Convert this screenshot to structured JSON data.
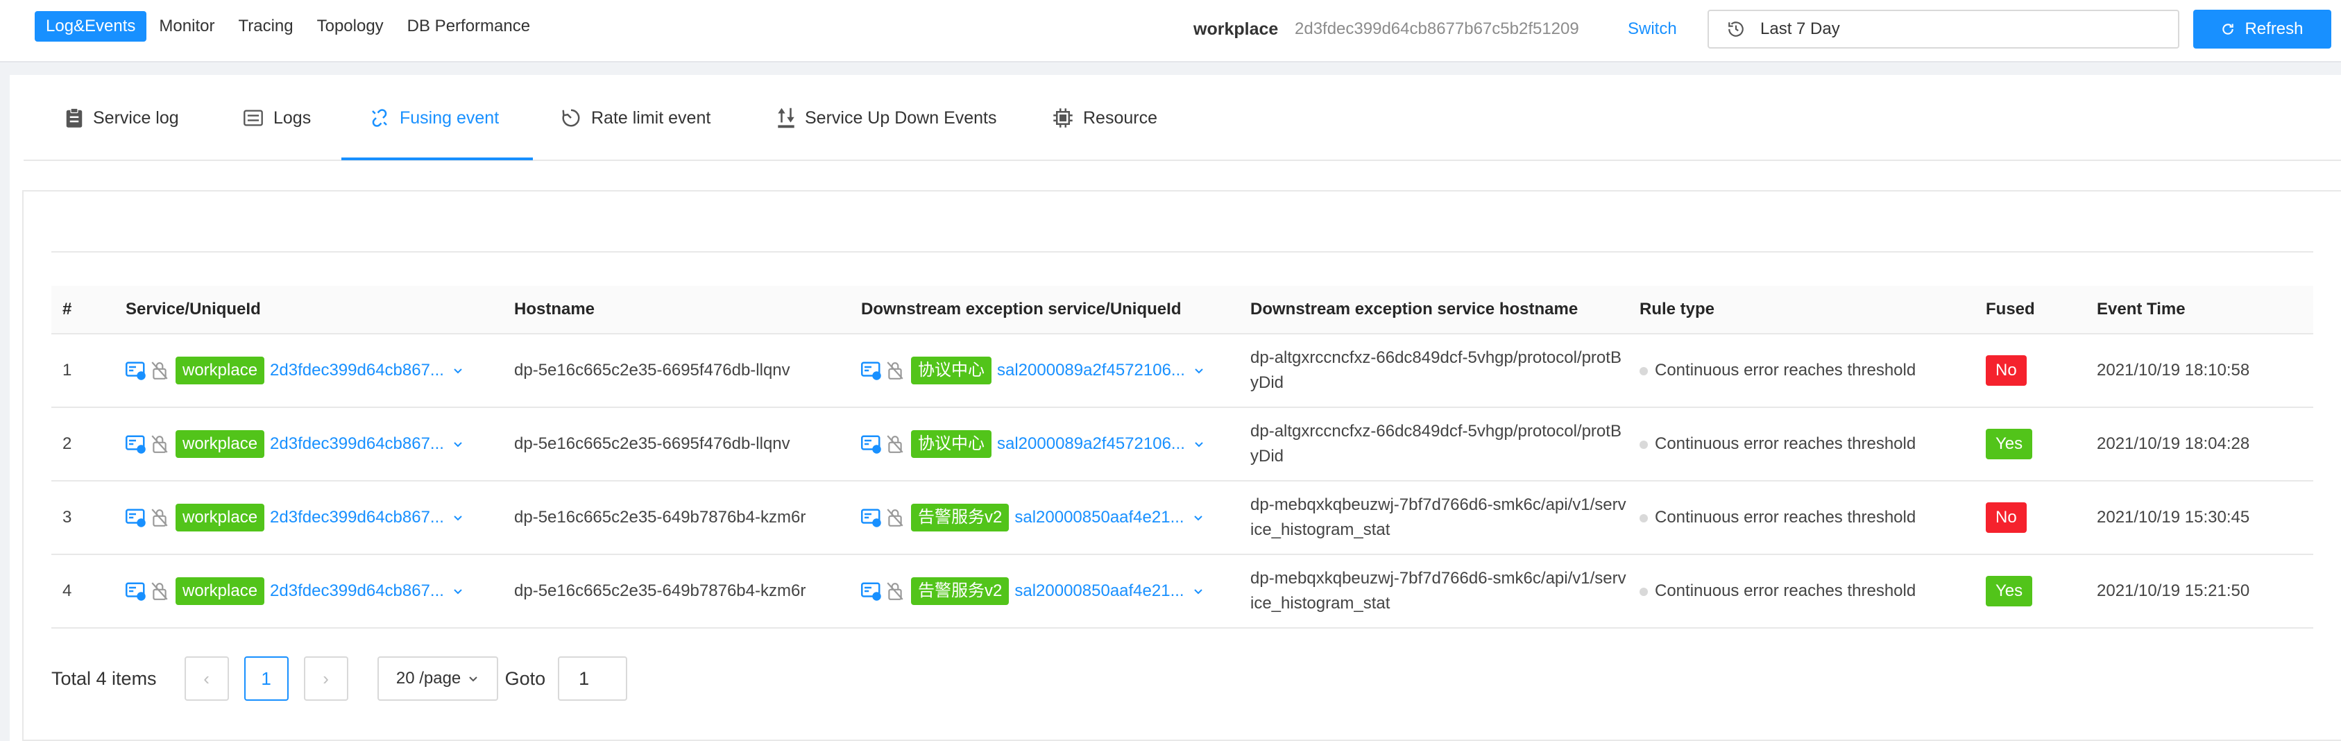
{
  "nav": {
    "items": [
      "Log&Events",
      "Monitor",
      "Tracing",
      "Topology",
      "DB Performance"
    ],
    "active": 0
  },
  "workspace": {
    "name": "workplace",
    "id": "2d3fdec399d64cb8677b67c5b2f51209",
    "switch_label": "Switch"
  },
  "time_range": {
    "label": "Last 7 Day",
    "icon": "history-clock-icon"
  },
  "refresh_label": "Refresh",
  "tabs": [
    {
      "label": "Service log",
      "icon": "clipboard-icon"
    },
    {
      "label": "Logs",
      "icon": "keyboard-icon"
    },
    {
      "label": "Fusing event",
      "icon": "broken-link-icon",
      "active": true
    },
    {
      "label": "Rate limit event",
      "icon": "timer-icon"
    },
    {
      "label": "Service Up Down Events",
      "icon": "arrows-up-down-icon"
    },
    {
      "label": "Resource",
      "icon": "chip-icon"
    }
  ],
  "table": {
    "columns": [
      "#",
      "Service/UniqueId",
      "Hostname",
      "Downstream exception service/UniqueId",
      "Downstream exception service hostname",
      "Rule type",
      "Fused",
      "Event Time"
    ],
    "rows": [
      {
        "index": "1",
        "service_tag": "workplace",
        "service_id": "2d3fdec399d64cb867...",
        "hostname": "dp-5e16c665c2e35-6695f476db-llqnv",
        "down_tag": "协议中心",
        "down_id": "sal2000089a2f4572106...",
        "down_hostname": "dp-altgxrccncfxz-66dc849dcf-5vhgp/protocol/protByDid",
        "rule": "Continuous error reaches threshold",
        "fused": "No",
        "fused_color": "#f5222d",
        "time": "2021/10/19 18:10:58"
      },
      {
        "index": "2",
        "service_tag": "workplace",
        "service_id": "2d3fdec399d64cb867...",
        "hostname": "dp-5e16c665c2e35-6695f476db-llqnv",
        "down_tag": "协议中心",
        "down_id": "sal2000089a2f4572106...",
        "down_hostname": "dp-altgxrccncfxz-66dc849dcf-5vhgp/protocol/protByDid",
        "rule": "Continuous error reaches threshold",
        "fused": "Yes",
        "fused_color": "#52c41a",
        "time": "2021/10/19 18:04:28"
      },
      {
        "index": "3",
        "service_tag": "workplace",
        "service_id": "2d3fdec399d64cb867...",
        "hostname": "dp-5e16c665c2e35-649b7876b4-kzm6r",
        "down_tag": "告警服务v2",
        "down_id": "sal20000850aaf4e21...",
        "down_hostname": "dp-mebqxkqbeuzwj-7bf7d766d6-smk6c/api/v1/service_histogram_stat",
        "rule": "Continuous error reaches threshold",
        "fused": "No",
        "fused_color": "#f5222d",
        "time": "2021/10/19 15:30:45"
      },
      {
        "index": "4",
        "service_tag": "workplace",
        "service_id": "2d3fdec399d64cb867...",
        "hostname": "dp-5e16c665c2e35-649b7876b4-kzm6r",
        "down_tag": "告警服务v2",
        "down_id": "sal20000850aaf4e21...",
        "down_hostname": "dp-mebqxkqbeuzwj-7bf7d766d6-smk6c/api/v1/service_histogram_stat",
        "rule": "Continuous error reaches threshold",
        "fused": "Yes",
        "fused_color": "#52c41a",
        "time": "2021/10/19 15:21:50"
      }
    ]
  },
  "pagination": {
    "total_label": "Total 4 items",
    "prev": "‹",
    "current_page": "1",
    "next": "›",
    "page_size": "20 /page",
    "goto_label": "Goto",
    "goto_value": "1"
  },
  "colors": {
    "primary": "#1890ff",
    "success": "#52c41a",
    "danger": "#f5222d"
  }
}
